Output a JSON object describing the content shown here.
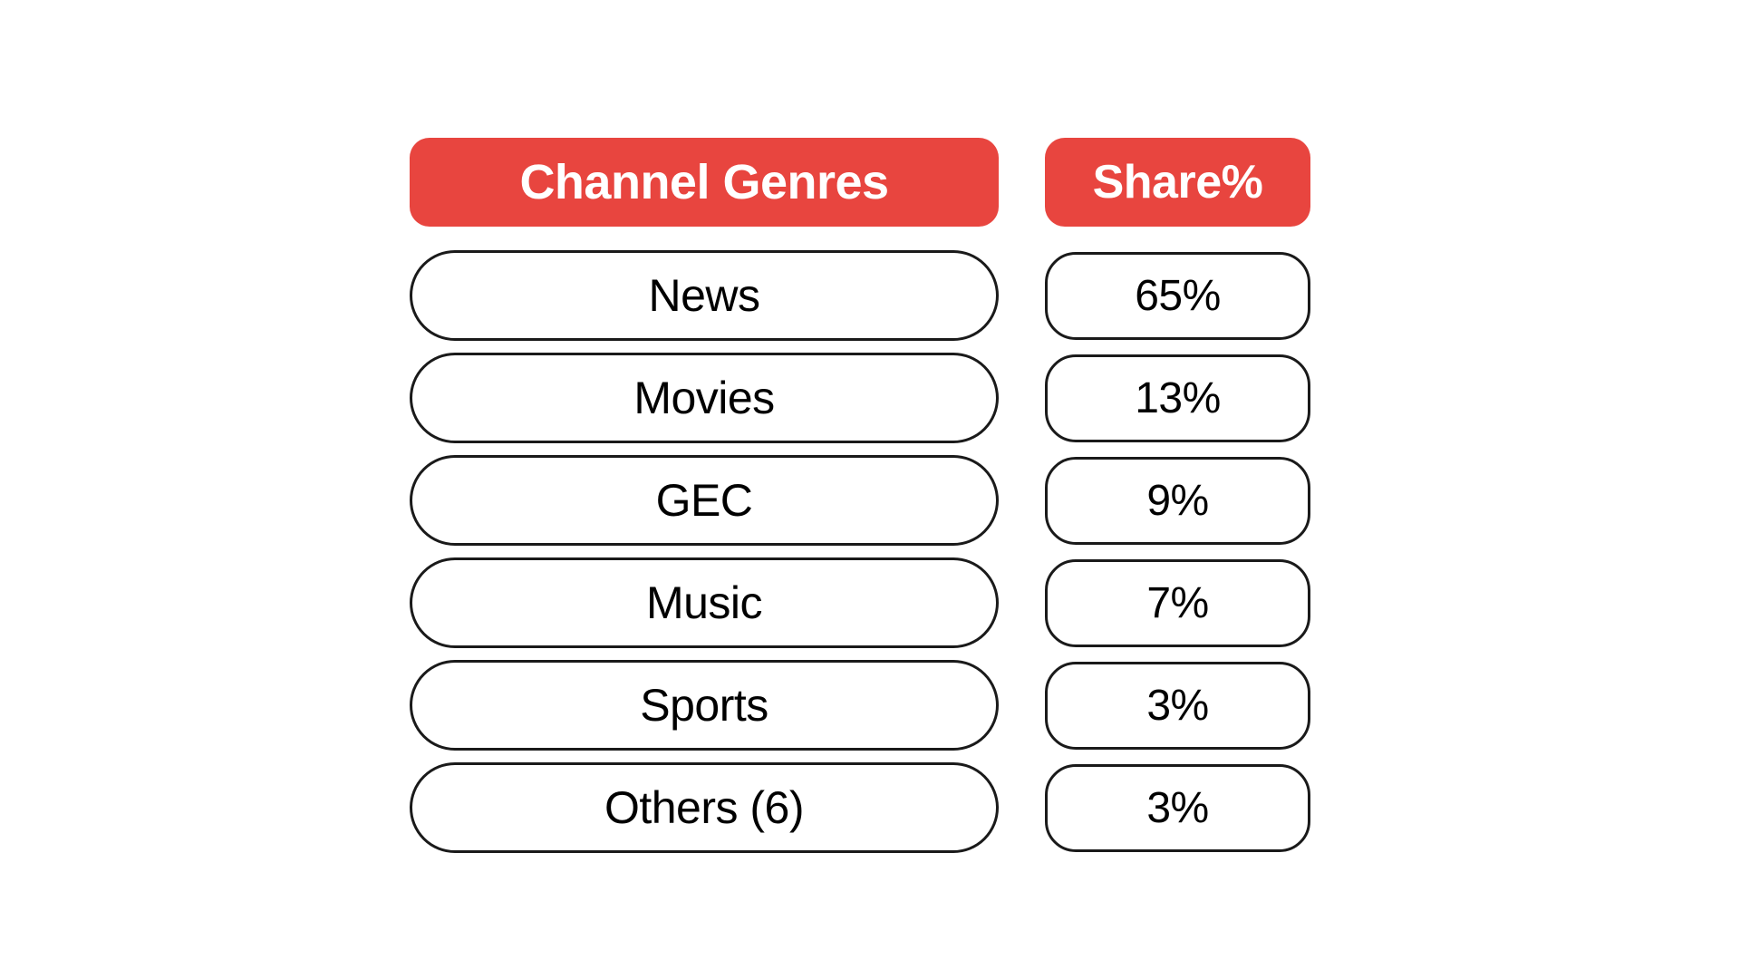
{
  "table": {
    "header": {
      "genre_label": "Channel Genres",
      "share_label": "Share%"
    },
    "rows": [
      {
        "genre": "News",
        "share": "65%"
      },
      {
        "genre": "Movies",
        "share": "13%"
      },
      {
        "genre": "GEC",
        "share": "9%"
      },
      {
        "genre": "Music",
        "share": "7%"
      },
      {
        "genre": "Sports",
        "share": "3%"
      },
      {
        "genre": "Others (6)",
        "share": "3%"
      }
    ]
  },
  "colors": {
    "header_background": "#e8453f",
    "header_text": "#ffffff",
    "row_border": "#1a1a1a",
    "row_text": "#000000",
    "page_background": "#ffffff"
  },
  "chart_data": {
    "type": "table",
    "title": "",
    "columns": [
      "Channel Genres",
      "Share%"
    ],
    "categories": [
      "News",
      "Movies",
      "GEC",
      "Music",
      "Sports",
      "Others (6)"
    ],
    "values": [
      65,
      13,
      9,
      7,
      3,
      3
    ],
    "value_labels": [
      "65%",
      "13%",
      "9%",
      "7%",
      "3%",
      "3%"
    ],
    "xlabel": "Channel Genres",
    "ylabel": "Share%",
    "ylim": [
      0,
      100
    ],
    "grid": false,
    "legend": "none"
  }
}
